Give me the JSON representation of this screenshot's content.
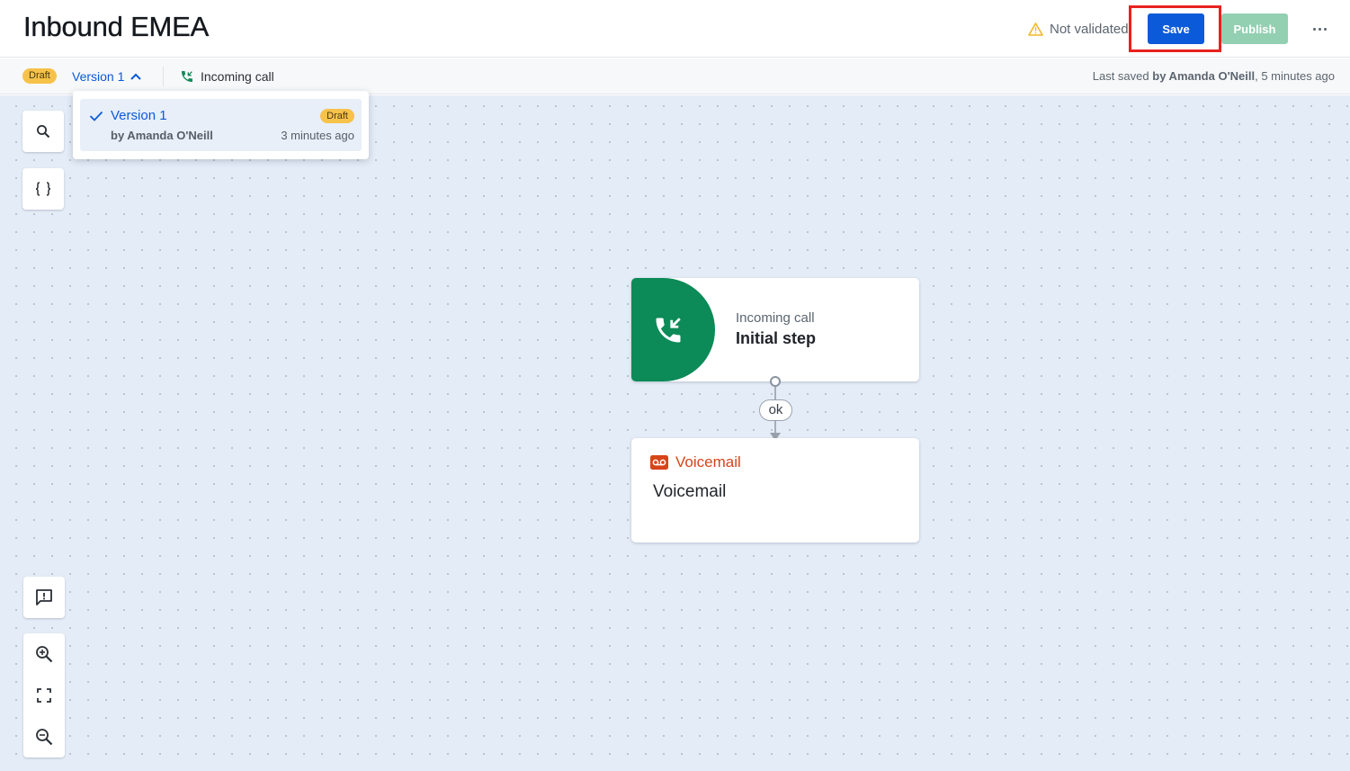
{
  "header": {
    "title": "Inbound EMEA",
    "validation_status": "Not validated",
    "save_label": "Save",
    "publish_label": "Publish",
    "more_icon": "more-horizontal-icon",
    "colors": {
      "primary": "#0b5ad9",
      "publish_disabled": "#92d0b1",
      "highlight": "#e8221f",
      "warning": "#f2b824"
    }
  },
  "subheader": {
    "status_badge": "Draft",
    "version_label": "Version 1",
    "trigger_label": "Incoming call",
    "last_saved_prefix": "Last saved",
    "last_saved_by": "by Amanda O'Neill",
    "last_saved_when": ", 5 minutes ago"
  },
  "version_dropdown": {
    "versions": [
      {
        "name": "Version 1",
        "badge": "Draft",
        "author": "by Amanda O'Neill",
        "time": "3 minutes ago",
        "selected": true
      }
    ]
  },
  "toolbar": {
    "tools": [
      "search-icon",
      "variables-icon",
      "feedback-icon",
      "zoom-in-icon",
      "fit-screen-icon",
      "zoom-out-icon"
    ]
  },
  "flow": {
    "nodes": [
      {
        "type": "Incoming call",
        "title": "Initial step",
        "color": "#0c8a57"
      },
      {
        "type": "Voicemail",
        "title": "Voicemail",
        "color": "#d8441a"
      }
    ],
    "edge_label": "ok"
  }
}
